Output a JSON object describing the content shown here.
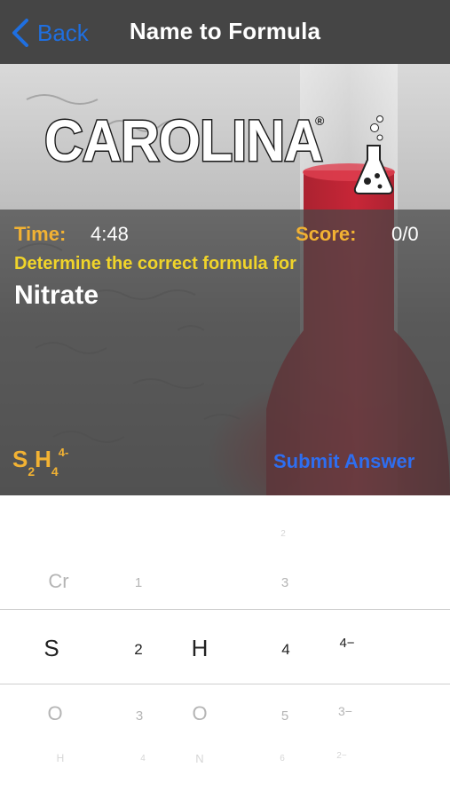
{
  "nav": {
    "back_label": "Back",
    "title": "Name to Formula"
  },
  "brand": {
    "logo_text": "CAROLINA",
    "registered": "®"
  },
  "quiz": {
    "time_label": "Time:",
    "time_value": "4:48",
    "score_label": "Score:",
    "score_value": "0/0",
    "prompt": "Determine the correct formula for",
    "compound": "Nitrate"
  },
  "answer": {
    "preview": {
      "el1": "S",
      "sub1": "2",
      "el2": "H",
      "sub2": "4",
      "charge": "4-"
    },
    "submit_label": "Submit Answer"
  },
  "picker": {
    "columns": [
      {
        "name": "element1",
        "above_far": "",
        "above": "Cr",
        "selected": "S",
        "below": "O",
        "below_far": "H"
      },
      {
        "name": "subscript1",
        "above_far": "",
        "above": "1",
        "selected": "2",
        "below": "3",
        "below_far": "4"
      },
      {
        "name": "element2",
        "above_far": "",
        "above": "",
        "selected": "H",
        "below": "O",
        "below_far": "N"
      },
      {
        "name": "subscript2",
        "above_far": "2",
        "above": "3",
        "selected": "4",
        "below": "5",
        "below_far": "6"
      },
      {
        "name": "charge",
        "above_far": "",
        "above": "",
        "selected": "4−",
        "below": "3−",
        "below_far": "2−"
      }
    ]
  },
  "colors": {
    "navbar": "#454545",
    "accent_blue": "#2e6ef0",
    "label_orange": "#f2b233",
    "prompt_yellow": "#f0d42a"
  },
  "icons": [
    "chevron-left-icon",
    "flask-icon"
  ]
}
